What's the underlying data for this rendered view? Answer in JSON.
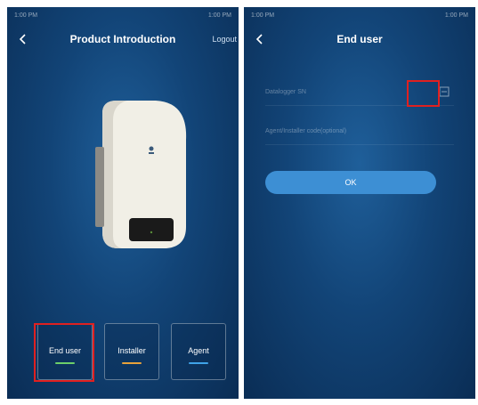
{
  "left_screen": {
    "status": {
      "left": "1:00 PM",
      "right": "1:00 PM"
    },
    "title": "Product Introduction",
    "logout_label": "Logout",
    "roles": [
      {
        "label": "End user",
        "accent": "#6ccf6a"
      },
      {
        "label": "Installer",
        "accent": "#e8a23a"
      },
      {
        "label": "Agent",
        "accent": "#3fa3e8"
      }
    ]
  },
  "right_screen": {
    "status": {
      "left": "1:00 PM",
      "right": "1:00 PM"
    },
    "title": "End user",
    "fields": [
      {
        "placeholder": "Datalogger SN",
        "icon": "scan-icon"
      },
      {
        "placeholder": "Agent/Installer code(optional)"
      }
    ],
    "ok_label": "OK"
  },
  "colors": {
    "highlight": "#e02020",
    "ok_button": "#3d8fd4",
    "background": "#124477"
  }
}
